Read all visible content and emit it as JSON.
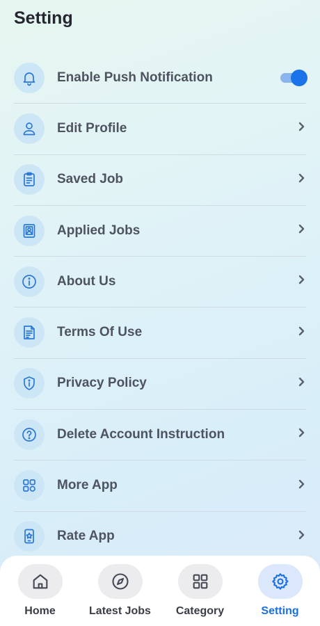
{
  "header": {
    "title": "Setting"
  },
  "settings": {
    "items": [
      {
        "label": "Enable Push Notification",
        "icon": "bell-icon",
        "control": "toggle",
        "enabled": true
      },
      {
        "label": "Edit Profile",
        "icon": "user-icon",
        "control": "chevron"
      },
      {
        "label": "Saved Job",
        "icon": "clipboard-icon",
        "control": "chevron"
      },
      {
        "label": "Applied Jobs",
        "icon": "id-badge-icon",
        "control": "chevron"
      },
      {
        "label": "About Us",
        "icon": "info-icon",
        "control": "chevron"
      },
      {
        "label": "Terms Of Use",
        "icon": "document-icon",
        "control": "chevron"
      },
      {
        "label": "Privacy Policy",
        "icon": "shield-icon",
        "control": "chevron"
      },
      {
        "label": "Delete Account Instruction",
        "icon": "question-icon",
        "control": "chevron"
      },
      {
        "label": "More App",
        "icon": "apps-icon",
        "control": "chevron"
      },
      {
        "label": "Rate App",
        "icon": "phone-star-icon",
        "control": "chevron"
      }
    ]
  },
  "nav": {
    "items": [
      {
        "label": "Home",
        "icon": "home-icon",
        "active": false
      },
      {
        "label": "Latest Jobs",
        "icon": "compass-icon",
        "active": false
      },
      {
        "label": "Category",
        "icon": "grid-icon",
        "active": false
      },
      {
        "label": "Setting",
        "icon": "gear-icon",
        "active": true
      }
    ]
  },
  "colors": {
    "accent": "#1a73e8",
    "icon_bg": "#cde6f6",
    "text": "#4e5360"
  }
}
